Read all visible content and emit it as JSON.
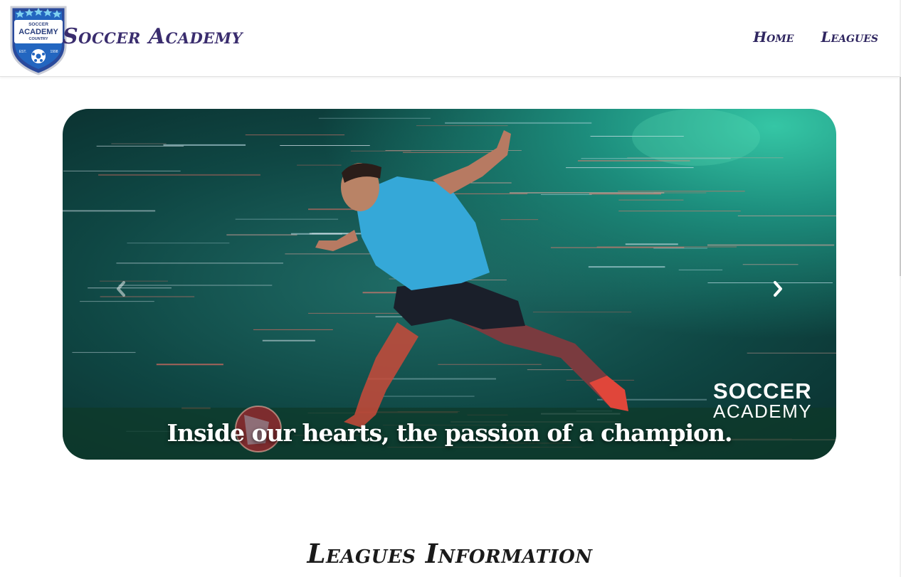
{
  "header": {
    "brand_title": "Soccer Academy",
    "logo_text": {
      "line1": "SOCCER",
      "line2": "ACADEMY",
      "line3": "COUNTRY",
      "est": "EST.",
      "year": "1998"
    },
    "nav": [
      {
        "label": "Home"
      },
      {
        "label": "Leagues"
      }
    ]
  },
  "carousel": {
    "caption": "Inside our hearts, the passion of a champion.",
    "watermark": {
      "line1": "SOCCER",
      "line2": "ACADEMY"
    },
    "prev_icon": "chevron-left-icon",
    "next_icon": "chevron-right-icon"
  },
  "section": {
    "title": "Leagues Information"
  },
  "colors": {
    "brand": "#3a2d6e",
    "nav": "#2f2660",
    "carousel_bg": "#0f4744",
    "accent_glow": "#35c6a5"
  }
}
